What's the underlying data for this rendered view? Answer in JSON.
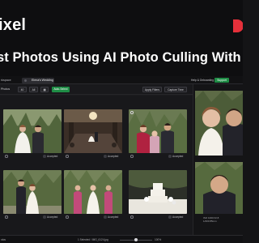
{
  "banner": {
    "brand": "ixel",
    "headline": "st Photos Using AI Photo Culling With I"
  },
  "colors": {
    "accent_green": "#1f8d46",
    "brand_red": "#e5303a"
  },
  "tabs": {
    "left": "rkspace",
    "active": "Elena's Wedding"
  },
  "header_right": {
    "help": "Help & Onboarding",
    "support": "Support"
  },
  "toolbar": {
    "label": "Photos",
    "chip_1": "40",
    "chip_2": "All",
    "select_button": "Auto-Select",
    "apply_button": "Apply Filters",
    "capture_button": "Capture Time"
  },
  "photos": [
    {
      "status": "Accepted",
      "selected": false
    },
    {
      "status": "Accepted",
      "selected": false
    },
    {
      "status": "Accepted",
      "selected": true
    },
    {
      "status": "Accepted",
      "selected": false
    },
    {
      "status": "Accepted",
      "selected": false
    },
    {
      "status": "Accepted",
      "selected": false
    }
  ],
  "status_bar": {
    "left": "otos",
    "middle": "1 Selected / IMG_6124.jpg",
    "zoom": "100%"
  },
  "preview": {
    "meta_1": "ISO 1000  f/2.8",
    "meta_2": "1/200  85mm"
  }
}
